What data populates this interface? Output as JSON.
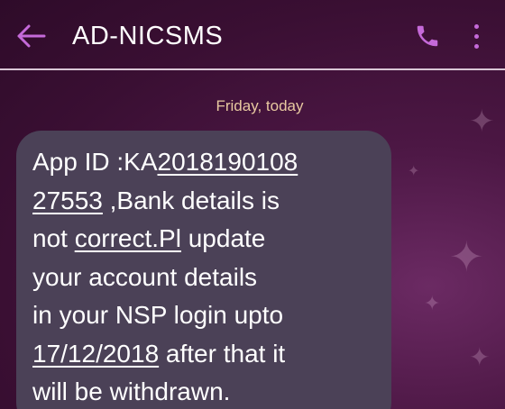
{
  "header": {
    "title": "AD-NICSMS",
    "back_icon": "arrow-left-icon",
    "call_icon": "phone-icon",
    "menu_icon": "more-vertical-icon"
  },
  "conversation": {
    "date_separator": "Friday, today",
    "message": {
      "line1_text": "App ID :KA",
      "line1_link": "2018190108",
      "line2_link": "27553",
      "line2_text": " ,Bank details is",
      "line3_text_a": "not ",
      "line3_link": "correct.Pl",
      "line3_text_b": " update",
      "line4_text": "your account details",
      "line5_text": "in your NSP login upto",
      "line6_link": "17/12/2018",
      "line6_text": " after that it",
      "line7_text": "will be withdrawn."
    }
  },
  "colors": {
    "accent": "#c56ad9",
    "background": "#3a0f33",
    "bubble": "#4b4157",
    "date_text": "#e8c9a0",
    "divider": "#d9c7d6"
  }
}
